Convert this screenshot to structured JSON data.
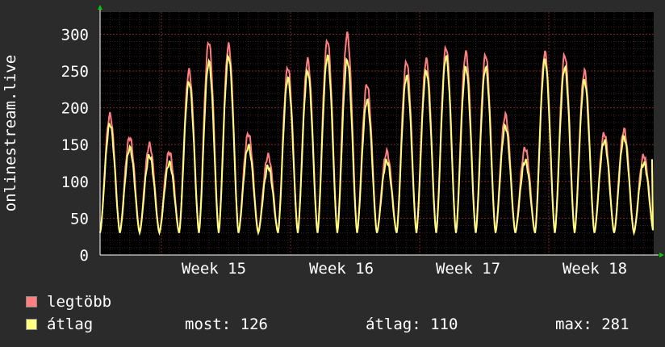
{
  "chart_data": {
    "type": "line",
    "ylabel": "onlinestream.live",
    "ylim": [
      0,
      330
    ],
    "yticks": [
      0,
      50,
      100,
      150,
      200,
      250,
      300
    ],
    "x_labels": [
      "Week 15",
      "Week 16",
      "Week 17",
      "Week 18"
    ],
    "grid": true,
    "background": "#000000",
    "series": [
      {
        "name": "legtöbb",
        "color": "#ff7f7f",
        "values": [
          {
            "day": 1,
            "peak": 190
          },
          {
            "day": 2,
            "peak": 160
          },
          {
            "day": 3,
            "peak": 150
          },
          {
            "day": 4,
            "peak": 140
          },
          {
            "day": 5,
            "peak": 250
          },
          {
            "day": 6,
            "peak": 290
          },
          {
            "day": 7,
            "peak": 285
          },
          {
            "day": 8,
            "peak": 165
          },
          {
            "day": 9,
            "peak": 135
          },
          {
            "day": 10,
            "peak": 255
          },
          {
            "day": 11,
            "peak": 265
          },
          {
            "day": 12,
            "peak": 292
          },
          {
            "day": 13,
            "peak": 300
          },
          {
            "day": 14,
            "peak": 232
          },
          {
            "day": 15,
            "peak": 140
          },
          {
            "day": 16,
            "peak": 263
          },
          {
            "day": 17,
            "peak": 265
          },
          {
            "day": 18,
            "peak": 282
          },
          {
            "day": 19,
            "peak": 275
          },
          {
            "day": 20,
            "peak": 272
          },
          {
            "day": 21,
            "peak": 190
          },
          {
            "day": 22,
            "peak": 145
          },
          {
            "day": 23,
            "peak": 275
          },
          {
            "day": 24,
            "peak": 272
          },
          {
            "day": 25,
            "peak": 250
          },
          {
            "day": 26,
            "peak": 165
          },
          {
            "day": 27,
            "peak": 170
          },
          {
            "day": 28,
            "peak": 135
          }
        ]
      },
      {
        "name": "átlag",
        "color": "#ffff7f",
        "values": [
          {
            "day": 1,
            "peak": 178
          },
          {
            "day": 2,
            "peak": 145
          },
          {
            "day": 3,
            "peak": 135
          },
          {
            "day": 4,
            "peak": 125
          },
          {
            "day": 5,
            "peak": 235
          },
          {
            "day": 6,
            "peak": 262
          },
          {
            "day": 7,
            "peak": 270
          },
          {
            "day": 8,
            "peak": 148
          },
          {
            "day": 9,
            "peak": 120
          },
          {
            "day": 10,
            "peak": 240
          },
          {
            "day": 11,
            "peak": 250
          },
          {
            "day": 12,
            "peak": 270
          },
          {
            "day": 13,
            "peak": 265
          },
          {
            "day": 14,
            "peak": 210
          },
          {
            "day": 15,
            "peak": 128
          },
          {
            "day": 16,
            "peak": 243
          },
          {
            "day": 17,
            "peak": 250
          },
          {
            "day": 18,
            "peak": 270
          },
          {
            "day": 19,
            "peak": 255
          },
          {
            "day": 20,
            "peak": 255
          },
          {
            "day": 21,
            "peak": 175
          },
          {
            "day": 22,
            "peak": 128
          },
          {
            "day": 23,
            "peak": 265
          },
          {
            "day": 24,
            "peak": 255
          },
          {
            "day": 25,
            "peak": 237
          },
          {
            "day": 26,
            "peak": 155
          },
          {
            "day": 27,
            "peak": 160
          },
          {
            "day": 28,
            "peak": 125
          }
        ]
      }
    ],
    "trough": 30
  },
  "legend": [
    {
      "label": "legtöbb",
      "color": "#ff7f7f"
    },
    {
      "label": "átlag",
      "color": "#ffff7f"
    }
  ],
  "stats": {
    "now": "most: 126",
    "avg": "átlag: 110",
    "max": "max: 281"
  }
}
